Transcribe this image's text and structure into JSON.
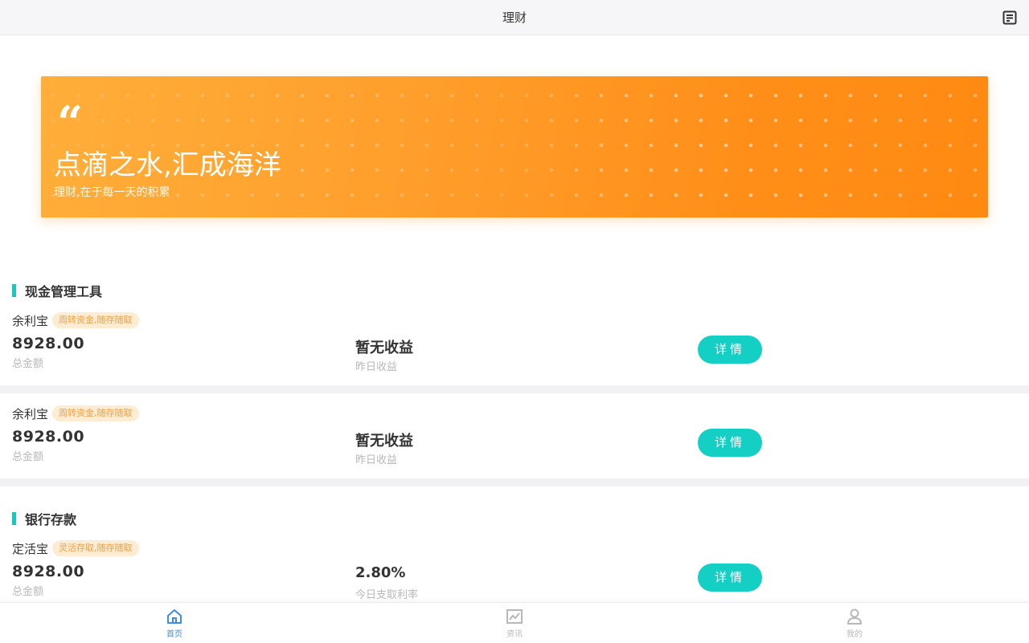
{
  "header": {
    "title": "理财",
    "icon": "document-icon"
  },
  "banner": {
    "quote_mark": "“",
    "title": "点滴之水,汇成海洋",
    "subtitle": "理财,在于每一天的积累"
  },
  "sections": [
    {
      "title": "现金管理工具"
    },
    {
      "title": "银行存款"
    }
  ],
  "products": [
    {
      "name": "余利宝",
      "tag": "周转资金,随存随取",
      "amount": "8928.00",
      "amount_label": "总金额",
      "yield": "暂无收益",
      "yield_label": "昨日收益",
      "button": "详情"
    },
    {
      "name": "余利宝",
      "tag": "周转资金,随存随取",
      "amount": "8928.00",
      "amount_label": "总金额",
      "yield": "暂无收益",
      "yield_label": "昨日收益",
      "button": "详情"
    },
    {
      "name": "定活宝",
      "tag": "灵活存取,随存随取",
      "amount": "8928.00",
      "amount_label": "总金额",
      "yield": "2.80%",
      "yield_label": "今日支取利率",
      "button": "详情"
    }
  ],
  "tabbar": {
    "items": [
      {
        "label": "首页",
        "icon": "home-icon",
        "active": true
      },
      {
        "label": "资讯",
        "icon": "chart-icon",
        "active": false
      },
      {
        "label": "我的",
        "icon": "user-icon",
        "active": false
      }
    ]
  },
  "colors": {
    "accent": "#14cfc4",
    "banner_orange": "#ff9e2b",
    "tab_active": "#3a8ee6"
  }
}
